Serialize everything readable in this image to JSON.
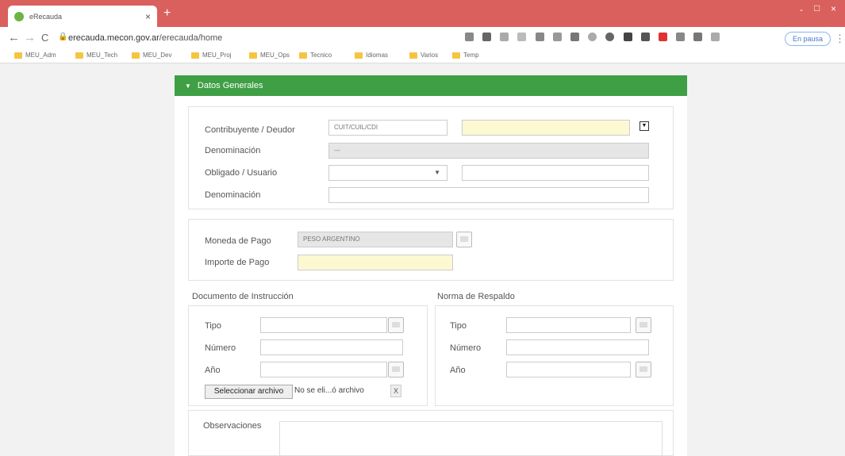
{
  "browser": {
    "tab_title": "eRecauda",
    "tab_close": "×",
    "new_tab": "+",
    "window_min": "-",
    "window_max": "□",
    "window_close": "×",
    "nav_back": "←",
    "nav_forward": "→",
    "nav_reload": "C",
    "address": {
      "host": "erecauda.mecon.gov.ar",
      "path": "/erecauda/home"
    },
    "paused_label": "En pausa",
    "more": "⋮"
  },
  "bookmarks": [
    "MEU_Adm",
    "MEU_Tech",
    "MEU_Dev",
    "MEU_Proj",
    "MEU_Ops",
    "Tecnico",
    "Idiomas",
    "Varios",
    "Temp"
  ],
  "form": {
    "section_title": "Datos Generales",
    "contribuyente_label": "Contribuyente / Deudor",
    "cuit_placeholder": "CUIT/CUIL/CDI",
    "denominacion_label": "Denominación",
    "denominacion_value": "---",
    "obligado_label": "Obligado / Usuario",
    "denominacion2_label": "Denominación",
    "moneda_label": "Moneda de Pago",
    "moneda_value": "PESO ARGENTINO",
    "importe_label": "Importe de Pago",
    "doc_section": "Documento de Instrucción",
    "doc_tipo": "Tipo",
    "doc_numero": "Número",
    "doc_anio": "Año",
    "file_button": "Seleccionar archivo",
    "file_note": "No se eli...ó archivo",
    "clear_file": "X",
    "norma_section": "Norma de Respaldo",
    "norma_tipo": "Tipo",
    "norma_numero": "Número",
    "norma_anio": "Año",
    "observaciones_label": "Observaciones"
  },
  "colors": {
    "accent_green": "#3f9f45",
    "titlebar_red": "#d9605d",
    "highlight_yellow": "#fcf8d2"
  }
}
